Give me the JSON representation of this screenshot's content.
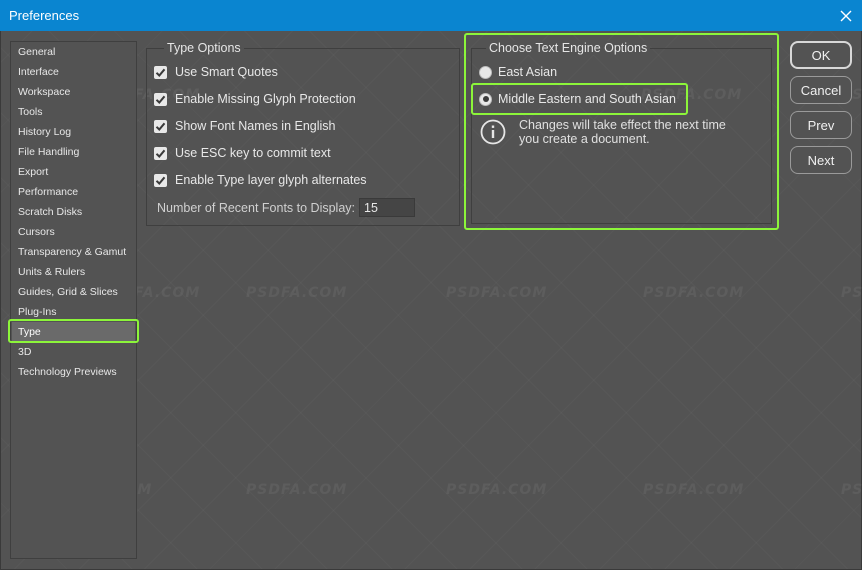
{
  "window": {
    "title": "Preferences"
  },
  "sidebar": {
    "items": [
      {
        "label": "General"
      },
      {
        "label": "Interface"
      },
      {
        "label": "Workspace"
      },
      {
        "label": "Tools"
      },
      {
        "label": "History Log"
      },
      {
        "label": "File Handling"
      },
      {
        "label": "Export"
      },
      {
        "label": "Performance"
      },
      {
        "label": "Scratch Disks"
      },
      {
        "label": "Cursors"
      },
      {
        "label": "Transparency & Gamut"
      },
      {
        "label": "Units & Rulers"
      },
      {
        "label": "Guides, Grid & Slices"
      },
      {
        "label": "Plug-Ins"
      },
      {
        "label": "Type"
      },
      {
        "label": "3D"
      },
      {
        "label": "Technology Previews"
      }
    ],
    "selected": "Type"
  },
  "type_options": {
    "title": "Type Options",
    "checkboxes": [
      {
        "label": "Use Smart Quotes",
        "checked": true
      },
      {
        "label": "Enable Missing Glyph Protection",
        "checked": true
      },
      {
        "label": "Show Font Names in English",
        "checked": true
      },
      {
        "label": "Use ESC key to commit text",
        "checked": true
      },
      {
        "label": "Enable Type layer glyph alternates",
        "checked": true
      }
    ],
    "recent_fonts_label": "Number of Recent Fonts to Display:",
    "recent_fonts_value": "15"
  },
  "text_engine": {
    "title": "Choose Text Engine Options",
    "options": [
      {
        "label": "East Asian",
        "selected": false
      },
      {
        "label": "Middle Eastern and South Asian",
        "selected": true
      }
    ],
    "info_line1": "Changes will take effect the next time",
    "info_line2": "you create a document."
  },
  "buttons": {
    "ok": "OK",
    "cancel": "Cancel",
    "prev": "Prev",
    "next": "Next"
  },
  "watermark": "PSDFA.COM",
  "colors": {
    "titlebar": "#0a85d0",
    "panel": "#535353",
    "highlight": "#8cf53a"
  }
}
